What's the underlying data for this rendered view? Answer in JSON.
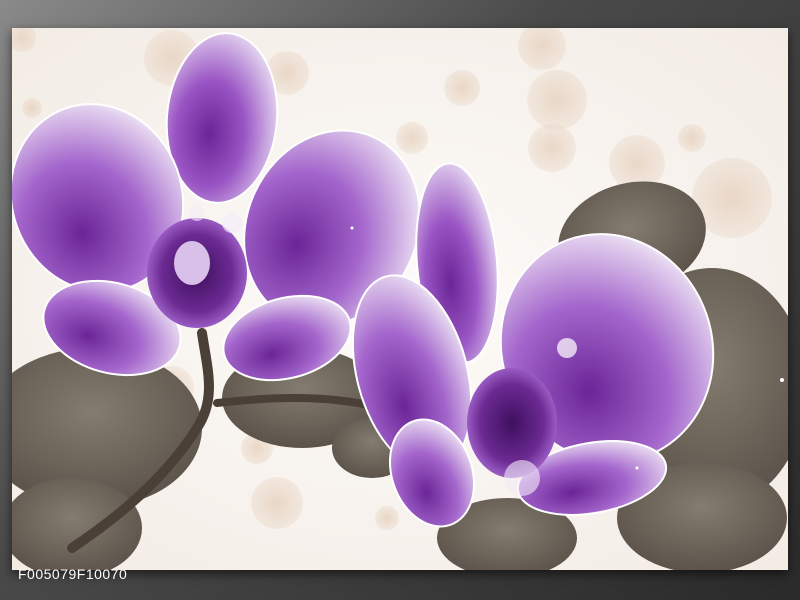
{
  "image": {
    "subject": "purple-orchids-on-white-bokeh",
    "colors": {
      "petal_purple": "#8a3fb4",
      "petal_light": "#e8d6f2",
      "leaf_gray": "#6b6358",
      "bokeh": "#e6d2bf",
      "background": "#fbf8f5",
      "frame": "#3a3a3a"
    }
  },
  "footer": {
    "product_code": "F005079F10070"
  }
}
